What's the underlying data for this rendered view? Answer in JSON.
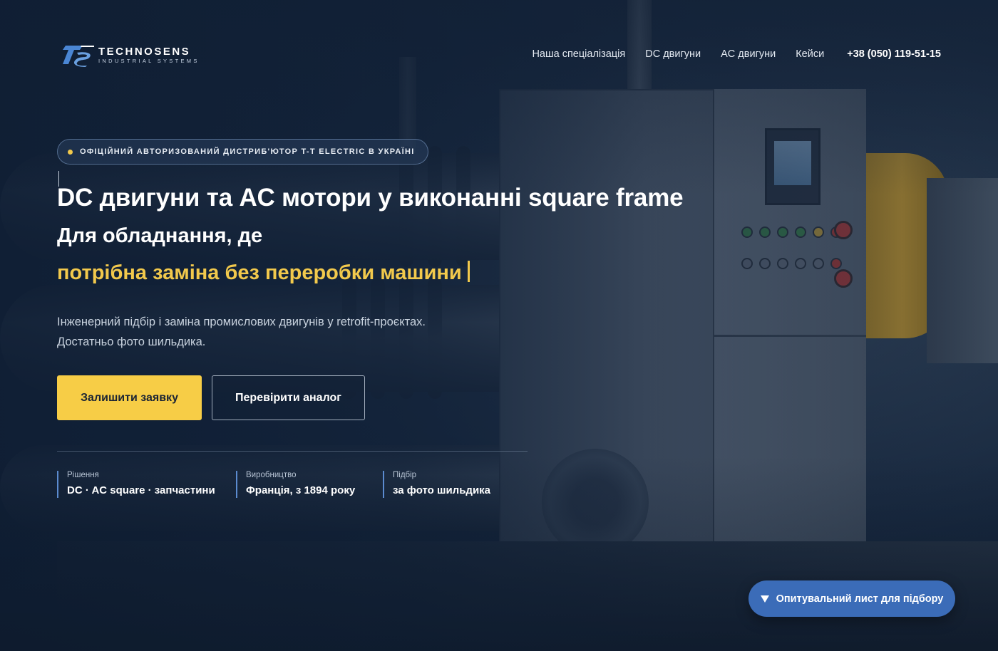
{
  "brand": {
    "name": "TECHNOSENS",
    "tagline": "INDUSTRIAL SYSTEMS",
    "accent_color": "#f7cd46",
    "blue_color": "#3b6cb8"
  },
  "nav": {
    "items": [
      {
        "label": "Наша спеціалізація"
      },
      {
        "label": "DC двигуни"
      },
      {
        "label": "AC двигуни"
      },
      {
        "label": "Кейси"
      }
    ],
    "phone": "+38 (050) 119-51-15"
  },
  "hero": {
    "badge": "ОФІЦІЙНИЙ АВТОРИЗОВАНИЙ ДИСТРИБ'ЮТОР T-T ELECTRIC В УКРАЇНІ",
    "title": "DC двигуни та AC мотори у виконанні square frame",
    "subtitle": "Для обладнання, де",
    "highlight": "потрібна заміна без переробки машини",
    "description_line1": "Інженерний підбір і заміна промислових двигунів у retrofit-проєктах.",
    "description_line2": "Достатньо фото шильдика.",
    "primary_button": "Залишити заявку",
    "secondary_button": "Перевірити аналог"
  },
  "stats": [
    {
      "label": "Рішення",
      "value": "DC · AC square · запчастини"
    },
    {
      "label": "Виробництво",
      "value": "Франція, з 1894 року"
    },
    {
      "label": "Підбір",
      "value": "за фото шильдика"
    }
  ],
  "survey": {
    "label": "Опитувальний лист для підбору",
    "icon": "triangle-down-icon"
  }
}
